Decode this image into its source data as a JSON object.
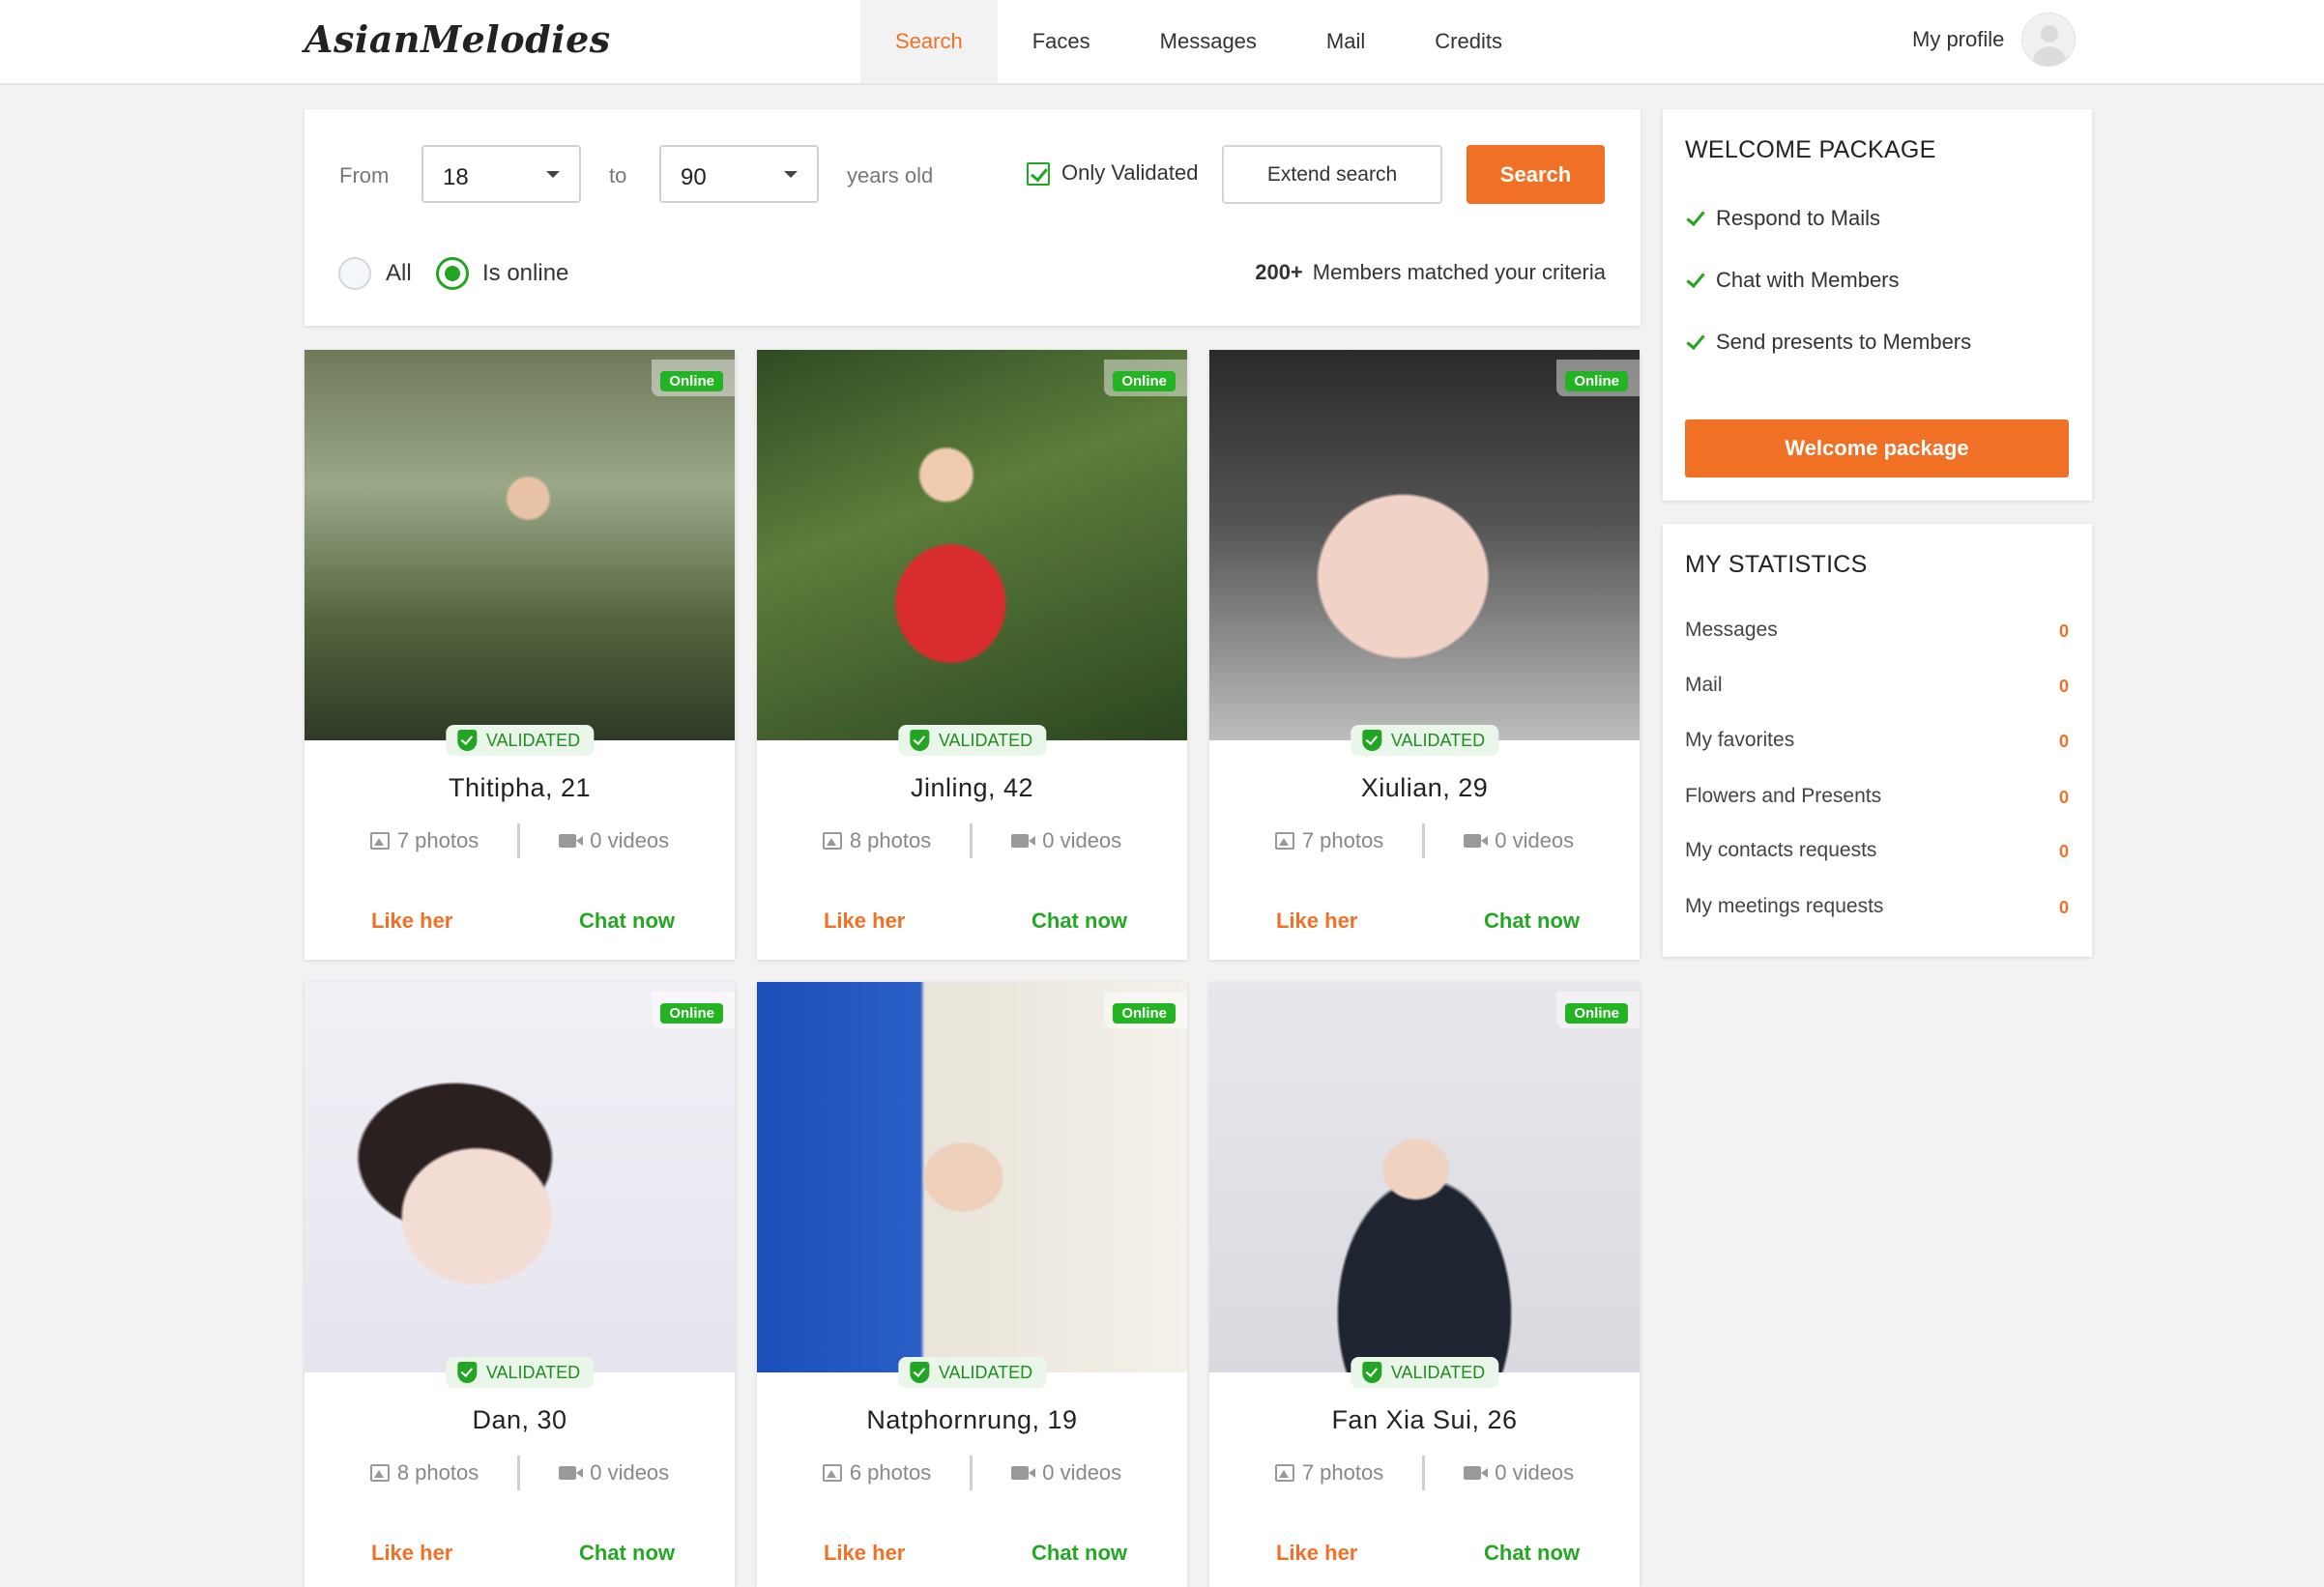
{
  "brand": "AsianMelodies",
  "nav": [
    "Search",
    "Faces",
    "Messages",
    "Mail",
    "Credits"
  ],
  "profile_label": "My profile",
  "filter": {
    "from_label": "From",
    "from_value": "18",
    "to_label": "to",
    "to_value": "90",
    "years_label": "years old",
    "only_validated": "Only Validated",
    "extend_search": "Extend search",
    "search": "Search",
    "radio_all": "All",
    "radio_online": "Is online",
    "matched_count": "200+",
    "matched_text": "Members matched your criteria"
  },
  "card_labels": {
    "online": "Online",
    "validated": "VALIDATED",
    "like": "Like her",
    "chat": "Chat now"
  },
  "members": [
    {
      "name": "Thitipha, 21",
      "photos": "7 photos",
      "videos": "0 videos"
    },
    {
      "name": "Jinling, 42",
      "photos": "8 photos",
      "videos": "0 videos"
    },
    {
      "name": "Xiulian, 29",
      "photos": "7 photos",
      "videos": "0 videos"
    },
    {
      "name": "Dan, 30",
      "photos": "8 photos",
      "videos": "0 videos"
    },
    {
      "name": "Natphornrung, 19",
      "photos": "6 photos",
      "videos": "0 videos"
    },
    {
      "name": "Fan Xia Sui, 26",
      "photos": "7 photos",
      "videos": "0 videos"
    }
  ],
  "welcome": {
    "title": "WELCOME PACKAGE",
    "items": [
      "Respond to Mails",
      "Chat with Members",
      "Send presents to Members"
    ],
    "button": "Welcome package"
  },
  "stats": {
    "title": "MY STATISTICS",
    "items": [
      {
        "label": "Messages",
        "value": "0"
      },
      {
        "label": "Mail",
        "value": "0"
      },
      {
        "label": "My favorites",
        "value": "0"
      },
      {
        "label": "Flowers and Presents",
        "value": "0"
      },
      {
        "label": "My contacts requests",
        "value": "0"
      },
      {
        "label": "My meetings requests",
        "value": "0"
      }
    ]
  },
  "colors": {
    "accent": "#f07125",
    "success": "#22a522"
  }
}
